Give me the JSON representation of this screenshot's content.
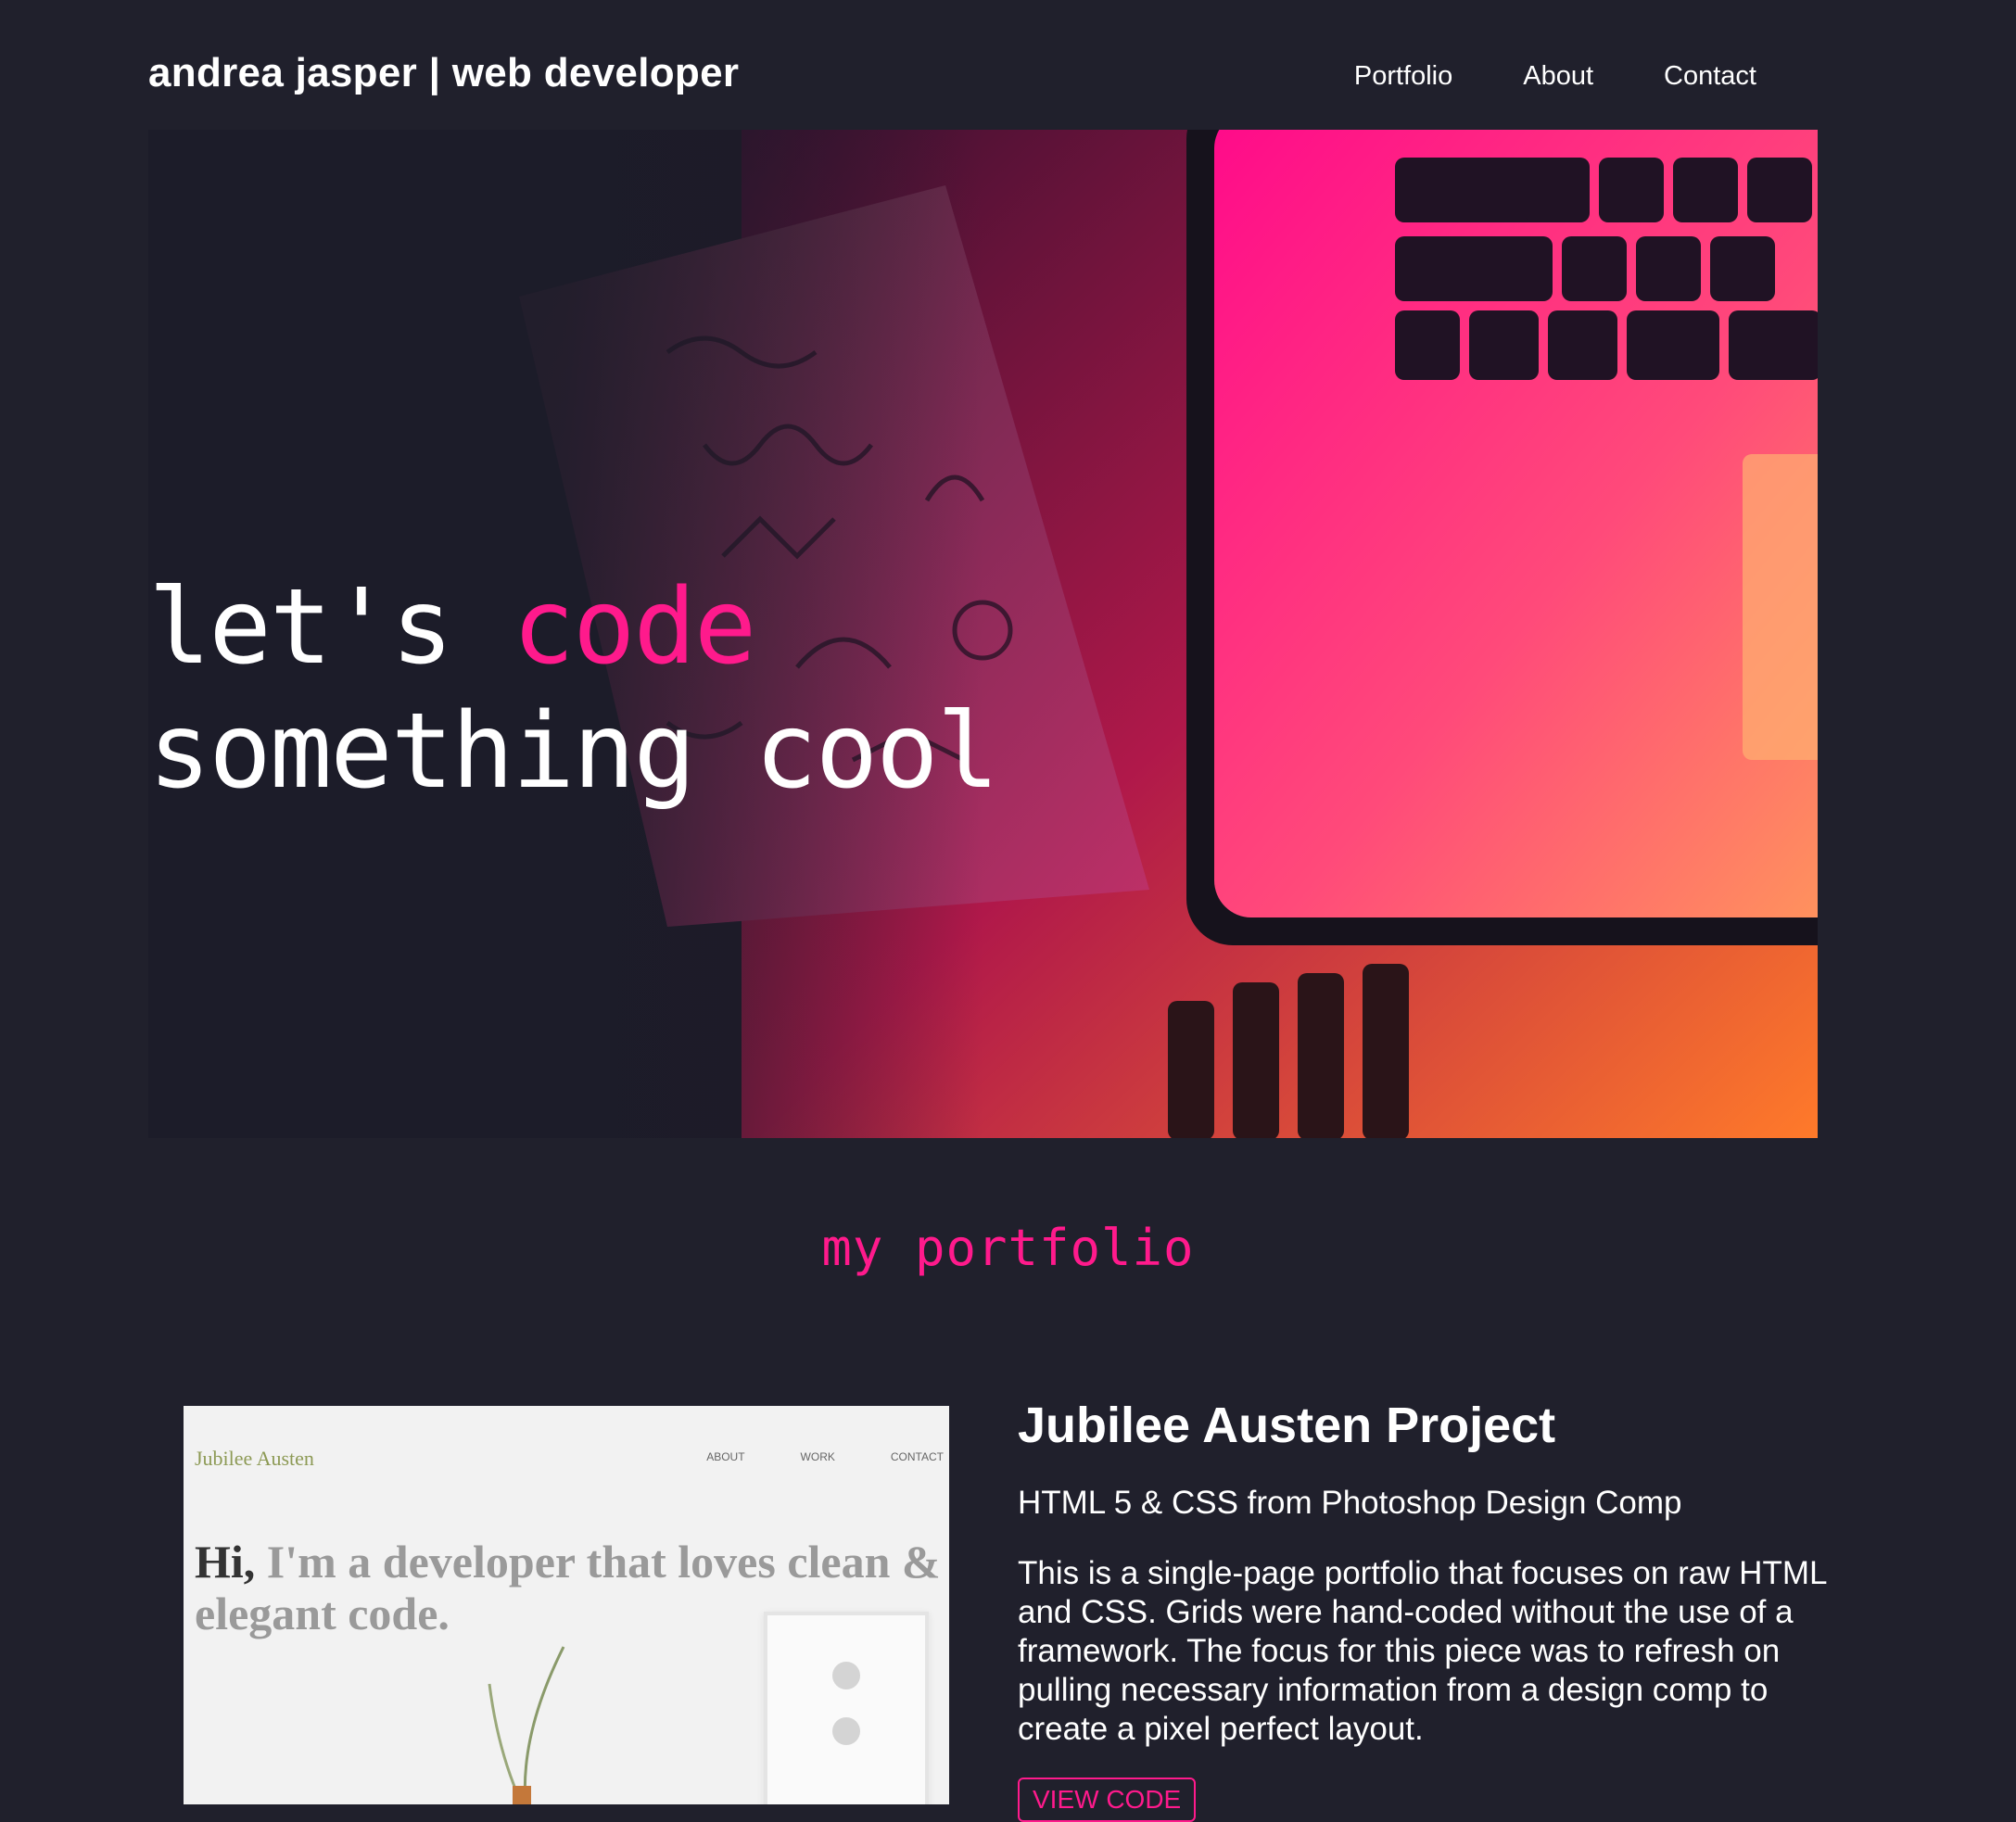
{
  "header": {
    "brand": "andrea jasper | web developer",
    "nav": [
      "Portfolio",
      "About",
      "Contact"
    ]
  },
  "hero": {
    "line1_prefix": "let's ",
    "line1_accent": "code",
    "line2": "something cool"
  },
  "portfolio": {
    "section_title": "my portfolio",
    "project": {
      "title": "Jubilee Austen Project",
      "subtitle": "HTML 5 & CSS from Photoshop Design Comp",
      "description": "This is a single-page portfolio that focuses on raw HTML and CSS. Grids were hand-coded without the use of a framework. The focus for this piece was to refresh on pulling necessary information from a design comp to create a pixel perfect layout.",
      "button_label": "VIEW CODE",
      "thumbnail": {
        "brand": "Jubilee Austen",
        "nav": [
          "ABOUT",
          "WORK",
          "CONTACT"
        ],
        "headline_bold": "Hi,",
        "headline_rest": " I'm a developer that loves clean & elegant code."
      }
    }
  },
  "colors": {
    "background": "#20202c",
    "accent": "#ff1a8c",
    "text": "#ffffff"
  }
}
